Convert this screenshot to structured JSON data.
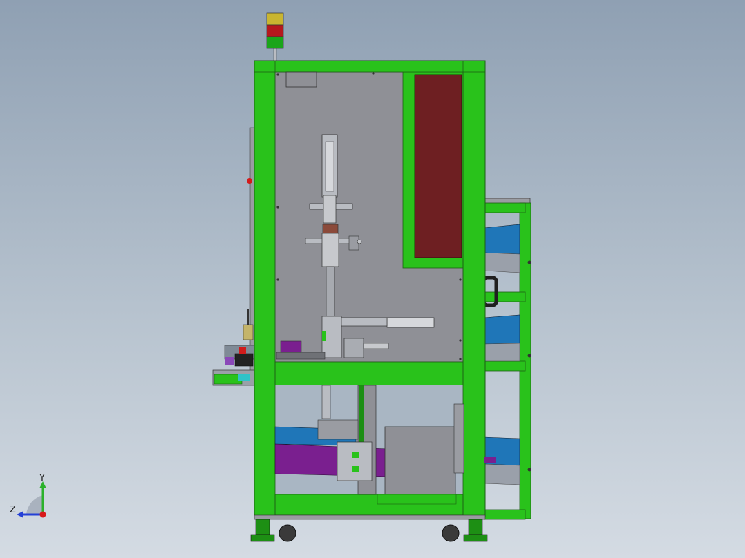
{
  "viewport": {
    "background_top": "#8fa0b3",
    "background_bottom": "#d4dbe3"
  },
  "colors": {
    "frame_green": "#29c21b",
    "frame_dark_green": "#1d8f14",
    "panel_gray": "#8f9096",
    "red_panel": "#6e1f22",
    "blue_belt": "#1f76b8",
    "purple_belt": "#7a1f8f",
    "steel": "#b9bcc2",
    "dark": "#3a3a3a"
  },
  "signal_tower": {
    "lights": [
      "yellow",
      "red",
      "green"
    ],
    "light_colors": [
      "#c9b530",
      "#b5181d",
      "#1aa51a"
    ]
  },
  "triad": {
    "y_label": "Y",
    "z_label": "Z",
    "y_color": "#2bb12b",
    "z_color": "#2440d6",
    "origin_color": "#d8191b"
  }
}
